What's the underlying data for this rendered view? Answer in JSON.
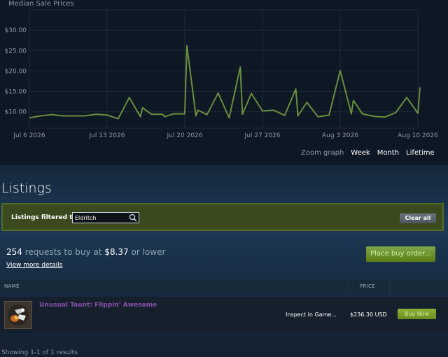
{
  "chart": {
    "title": "Median Sale Prices",
    "y_ticks": [
      "$30.00",
      "$25.00",
      "$20.00",
      "$15.00",
      "$10.00"
    ],
    "x_ticks": [
      "Jul 6 2026",
      "Jul 13 2026",
      "Jul 20 2026",
      "Jul 27 2026",
      "Aug 3 2026",
      "Aug 10 2026"
    ],
    "line_color": "#688f3e"
  },
  "chart_data": {
    "type": "line",
    "title": "Median Sale Prices",
    "xlabel": "",
    "ylabel": "",
    "x_range": [
      "2026-07-06",
      "2026-08-10"
    ],
    "ylim": [
      6,
      35
    ],
    "grid": true,
    "series": [
      {
        "name": "",
        "x": [
          "2026-07-06",
          "2026-07-07",
          "2026-07-08",
          "2026-07-09",
          "2026-07-10",
          "2026-07-11",
          "2026-07-12",
          "2026-07-13",
          "2026-07-14",
          "2026-07-15",
          "2026-07-16",
          "2026-07-16",
          "2026-07-17",
          "2026-07-18",
          "2026-07-18",
          "2026-07-19",
          "2026-07-20",
          "2026-07-20",
          "2026-07-21",
          "2026-07-21",
          "2026-07-22",
          "2026-07-23",
          "2026-07-24",
          "2026-07-25",
          "2026-07-25",
          "2026-07-26",
          "2026-07-27",
          "2026-07-28",
          "2026-07-29",
          "2026-07-30",
          "2026-07-30",
          "2026-07-31",
          "2026-08-01",
          "2026-08-02",
          "2026-08-03",
          "2026-08-04",
          "2026-08-04",
          "2026-08-05",
          "2026-08-06",
          "2026-08-07",
          "2026-08-08",
          "2026-08-09",
          "2026-08-10",
          "2026-08-10"
        ],
        "y": [
          8.5,
          9.0,
          9.3,
          9.0,
          9.0,
          9.0,
          9.4,
          9.2,
          8.3,
          13.5,
          8.8,
          11.0,
          9.4,
          9.4,
          8.8,
          9.5,
          9.5,
          26.2,
          9.0,
          10.4,
          9.3,
          14.6,
          8.5,
          21.0,
          9.4,
          14.5,
          10.2,
          10.4,
          9.1,
          15.6,
          9.0,
          12.3,
          8.8,
          9.2,
          20.1,
          9.5,
          12.8,
          9.5,
          8.9,
          8.7,
          9.8,
          13.5,
          9.6,
          16.0
        ]
      }
    ]
  },
  "zoom": {
    "label": "Zoom graph",
    "options": [
      "Week",
      "Month",
      "Lifetime"
    ]
  },
  "listings": {
    "title": "Listings",
    "filter_label": "Listings filtered to:",
    "filter_value": "Eldritch",
    "clear_all": "Clear all"
  },
  "buy_orders": {
    "count": "254",
    "text_middle": "requests to buy at",
    "price": "$8.37",
    "text_end": "or lower",
    "view_details": "View more details",
    "place_order": "Place buy order..."
  },
  "table": {
    "col_name": "NAME",
    "col_price": "PRICE",
    "rows": [
      {
        "name": "Unusual Taunt: Flippin' Awesome",
        "name_color": "#8650ac",
        "inspect": "Inspect in Game...",
        "price": "$236.30 USD",
        "buy": "Buy Now"
      }
    ]
  },
  "footer": {
    "showing": "Showing 1-1 of 1 results"
  }
}
